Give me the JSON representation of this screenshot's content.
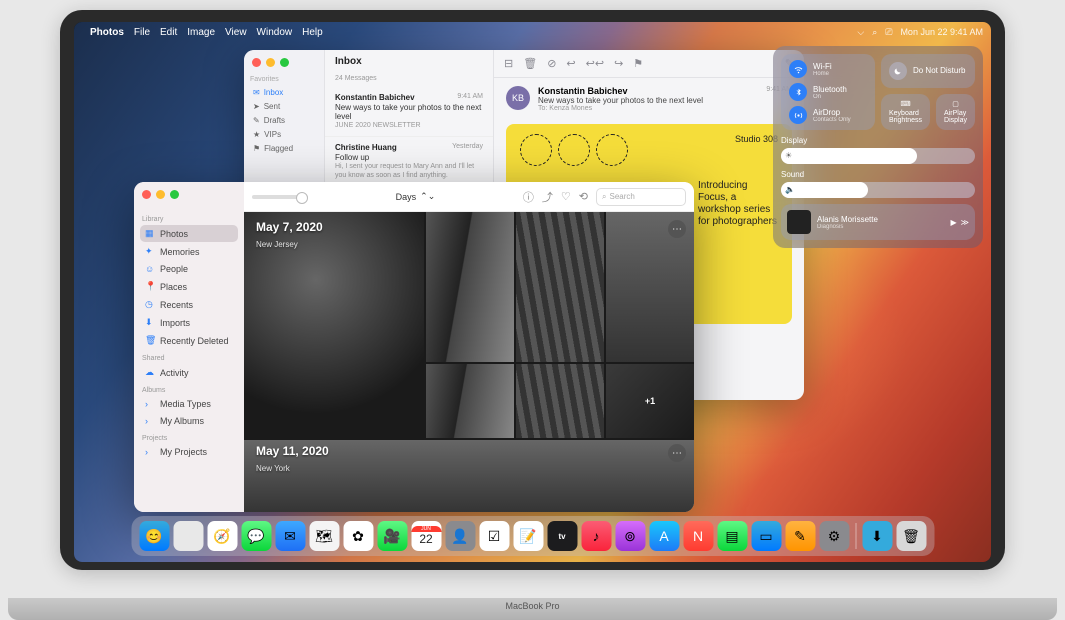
{
  "device_label": "MacBook Pro",
  "menubar": {
    "app": "Photos",
    "items": [
      "File",
      "Edit",
      "Image",
      "View",
      "Window",
      "Help"
    ],
    "datetime": "Mon Jun 22  9:41 AM"
  },
  "control_center": {
    "wifi": {
      "label": "Wi-Fi",
      "sub": "Home"
    },
    "bluetooth": {
      "label": "Bluetooth",
      "sub": "On"
    },
    "airdrop": {
      "label": "AirDrop",
      "sub": "Contacts Only"
    },
    "dnd": {
      "label": "Do Not Disturb"
    },
    "kb_brightness": {
      "label": "Keyboard Brightness"
    },
    "airplay": {
      "label": "AirPlay Display"
    },
    "display": {
      "label": "Display",
      "value": 70
    },
    "sound": {
      "label": "Sound",
      "value": 45
    },
    "nowplaying": {
      "title": "Alanis Morissette",
      "subtitle": "Diagnosis"
    }
  },
  "mail": {
    "sidebar": {
      "section": "Favorites",
      "items": [
        "Inbox",
        "Sent",
        "Drafts",
        "VIPs",
        "Flagged"
      ]
    },
    "listTitle": "Inbox",
    "listCount": "24 Messages",
    "messages": [
      {
        "from": "Konstantin Babichev",
        "time": "9:41 AM",
        "subject": "New ways to take your photos to the next level",
        "preview": "JUNE 2020 NEWSLETTER"
      },
      {
        "from": "Christine Huang",
        "time": "Yesterday",
        "subject": "Follow up",
        "preview": "Hi, I sent your request to Mary Ann and I'll let you know as soon as I find anything."
      }
    ],
    "open": {
      "initials": "KB",
      "from": "Konstantin Babichev",
      "subject": "New ways to take your photos to the next level",
      "to": "To: Kenza Mones",
      "time": "9:41 AM"
    },
    "attachment": {
      "brand": "Studio 308",
      "headline": "Introducing Focus, a workshop series for photographers"
    }
  },
  "photos": {
    "toolbar": {
      "view": "Days",
      "search_placeholder": "Search"
    },
    "sidebar": {
      "sections": {
        "library": "Library",
        "shared": "Shared",
        "albums": "Albums",
        "projects": "Projects"
      },
      "library": [
        "Photos",
        "Memories",
        "People",
        "Places",
        "Recents",
        "Imports",
        "Recently Deleted"
      ],
      "shared": [
        "Activity"
      ],
      "albums": [
        "Media Types",
        "My Albums"
      ],
      "projects": [
        "My Projects"
      ]
    },
    "days": [
      {
        "date": "May 7, 2020",
        "place": "New Jersey",
        "more": "+1"
      },
      {
        "date": "May 11, 2020",
        "place": "New York"
      }
    ]
  },
  "dock": {
    "cal_month": "JUN",
    "cal_day": "22"
  }
}
